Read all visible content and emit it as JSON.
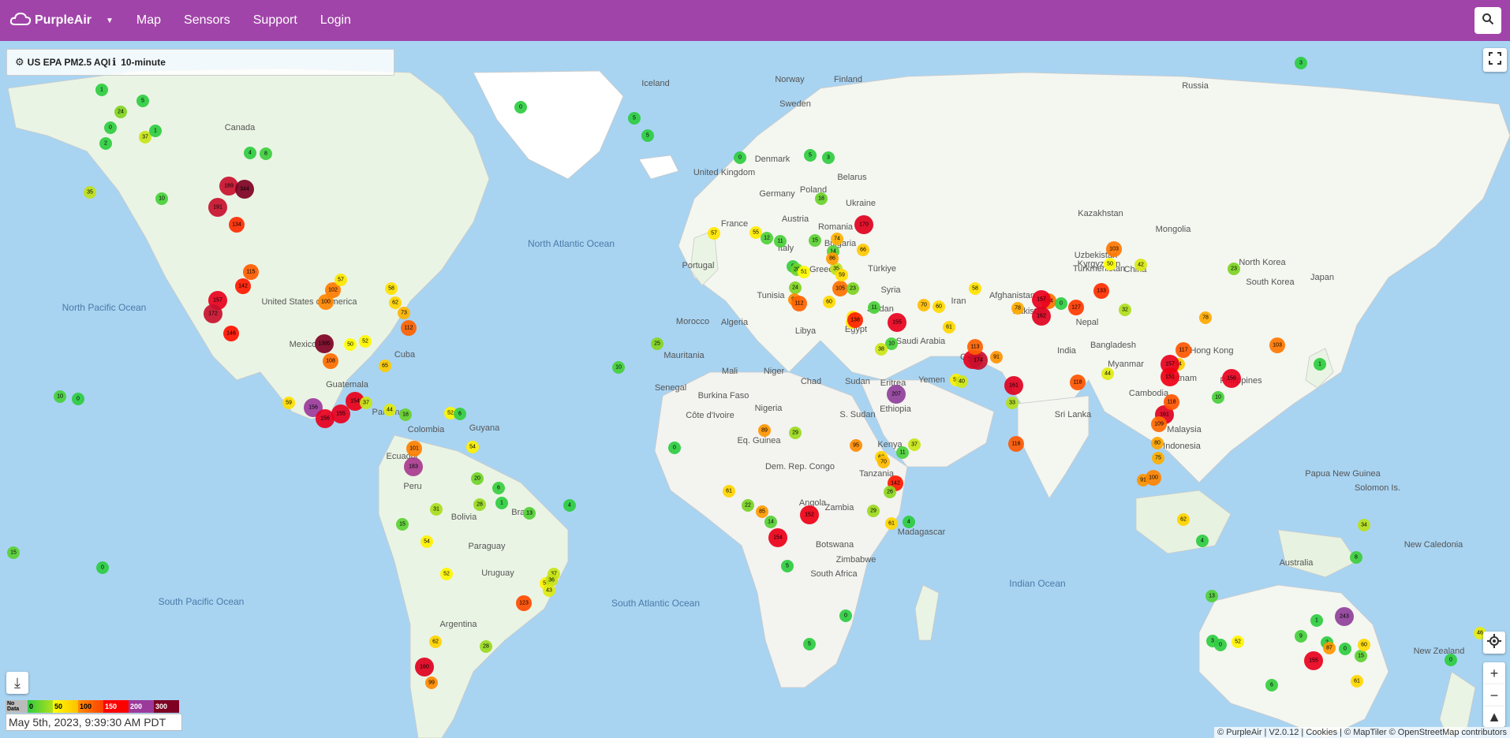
{
  "navbar": {
    "brand": "PurpleAir",
    "items": [
      {
        "label": "Map"
      },
      {
        "label": "Sensors"
      },
      {
        "label": "Support"
      },
      {
        "label": "Login"
      }
    ]
  },
  "panel": {
    "metric": "US EPA PM2.5 AQI",
    "interval": "10-minute"
  },
  "legend": {
    "no_data": "No Data",
    "ticks": [
      "0",
      "50",
      "100",
      "150",
      "200",
      "300"
    ],
    "colors": [
      "#2ecc40",
      "#ffff00",
      "#ff8c00",
      "#ff0000",
      "#9b3a9b",
      "#7e0023"
    ],
    "timestamp": "May 5th, 2023, 9:39:30 AM PDT"
  },
  "attribution": "© PurpleAir | V2.0.12 | Cookies | © MapTiler © OpenStreetMap contributors",
  "map_labels": {
    "countries": [
      "Canada",
      "United States of America",
      "Mexico",
      "Cuba",
      "Guatemala",
      "Panama",
      "Colombia",
      "Ecuador",
      "Peru",
      "Bolivia",
      "Brazil",
      "Paraguay",
      "Uruguay",
      "Argentina",
      "Guyana",
      "Iceland",
      "Norway",
      "Sweden",
      "Finland",
      "Denmark",
      "United Kingdom",
      "Germany",
      "France",
      "Portugal",
      "Italy",
      "Poland",
      "Austria",
      "Romania",
      "Bulgaria",
      "Greece",
      "Belarus",
      "Ukraine",
      "Türkiye",
      "Syria",
      "Jordan",
      "Tunisia",
      "Morocco",
      "Algeria",
      "Libya",
      "Egypt",
      "Mauritania",
      "Mali",
      "Niger",
      "Chad",
      "Sudan",
      "S. Sudan",
      "Eritrea",
      "Yemen",
      "Oman",
      "Saudi Arabia",
      "Iran",
      "Afghanistan",
      "Pakistan",
      "India",
      "Nepal",
      "Bangladesh",
      "Sri Lanka",
      "Myanmar",
      "Cambodia",
      "Vietnam",
      "Malaysia",
      "Indonesia",
      "Philippines",
      "Hong Kong",
      "China",
      "Mongolia",
      "Kazakhstan",
      "Uzbekistan",
      "Turkmenistan",
      "Kyrgyzstan",
      "North Korea",
      "South Korea",
      "Japan",
      "Russia",
      "Senegal",
      "Burkina Faso",
      "Côte d'Ivoire",
      "Nigeria",
      "Eq. Guinea",
      "Ethiopia",
      "Kenya",
      "Tanzania",
      "Dem. Rep. Congo",
      "Angola",
      "Zambia",
      "Zimbabwe",
      "Botswana",
      "South Africa",
      "Madagascar",
      "Papua New Guinea",
      "Solomon Is.",
      "New Caledonia",
      "Australia",
      "New Zealand"
    ],
    "oceans": [
      "North Pacific Ocean",
      "North Atlantic Ocean",
      "South Pacific Ocean",
      "South Atlantic Ocean",
      "Indian Ocean"
    ]
  },
  "sensors": [
    {
      "aqi": "1",
      "c": "#2ecc40"
    },
    {
      "aqi": "5",
      "c": "#2ecc40"
    },
    {
      "aqi": "24",
      "c": "#7fd321"
    },
    {
      "aqi": "37",
      "c": "#c8e417"
    },
    {
      "aqi": "0",
      "c": "#2ecc40"
    },
    {
      "aqi": "2",
      "c": "#2ecc40"
    },
    {
      "aqi": "35",
      "c": "#c0e11a"
    },
    {
      "aqi": "1",
      "c": "#2ecc40"
    },
    {
      "aqi": "10",
      "c": "#47cf3a"
    },
    {
      "aqi": "4",
      "c": "#2ecc40"
    },
    {
      "aqi": "8",
      "c": "#3ecd3d"
    },
    {
      "aqi": "189",
      "c": "#c8102e"
    },
    {
      "aqi": "344",
      "c": "#7e0023"
    },
    {
      "aqi": "191",
      "c": "#c8102e"
    },
    {
      "aqi": "134",
      "c": "#ff2a00"
    },
    {
      "aqi": "157",
      "c": "#e8001e"
    },
    {
      "aqi": "172",
      "c": "#c8102e"
    },
    {
      "aqi": "142",
      "c": "#ff1800"
    },
    {
      "aqi": "115",
      "c": "#ff5a00"
    },
    {
      "aqi": "146",
      "c": "#ff1000"
    },
    {
      "aqi": "102",
      "c": "#ff7a00"
    },
    {
      "aqi": "100",
      "c": "#ff8400"
    },
    {
      "aqi": "1395",
      "c": "#7e0023"
    },
    {
      "aqi": "108",
      "c": "#ff6c00"
    },
    {
      "aqi": "112",
      "c": "#ff6200"
    },
    {
      "aqi": "73",
      "c": "#ffb300"
    },
    {
      "aqi": "62",
      "c": "#ffd200"
    },
    {
      "aqi": "57",
      "c": "#ffe600"
    },
    {
      "aqi": "58",
      "c": "#ffe200"
    },
    {
      "aqi": "50",
      "c": "#ffff00"
    },
    {
      "aqi": "65",
      "c": "#ffca00"
    },
    {
      "aqi": "52",
      "c": "#fff500"
    },
    {
      "aqi": "59",
      "c": "#ffdd00"
    },
    {
      "aqi": "156",
      "c": "#9b3a9b"
    },
    {
      "aqi": "156",
      "c": "#e8001e"
    },
    {
      "aqi": "155",
      "c": "#e8001e"
    },
    {
      "aqi": "154",
      "c": "#ec0018"
    },
    {
      "aqi": "37",
      "c": "#c8e417"
    },
    {
      "aqi": "44",
      "c": "#e0ea10"
    },
    {
      "aqi": "18",
      "c": "#68d12b"
    },
    {
      "aqi": "52",
      "c": "#fff500"
    },
    {
      "aqi": "6",
      "c": "#36cd3f"
    },
    {
      "aqi": "25",
      "c": "#87d520"
    },
    {
      "aqi": "10",
      "c": "#47cf3a"
    },
    {
      "aqi": "0",
      "c": "#2ecc40"
    },
    {
      "aqi": "101",
      "c": "#ff7e00"
    },
    {
      "aqi": "183",
      "c": "#a83a8f"
    },
    {
      "aqi": "54",
      "c": "#fff000"
    },
    {
      "aqi": "20",
      "c": "#6fd229"
    },
    {
      "aqi": "31",
      "c": "#a8dc1c"
    },
    {
      "aqi": "28",
      "c": "#98d91e"
    },
    {
      "aqi": "1",
      "c": "#2ecc40"
    },
    {
      "aqi": "6",
      "c": "#36cd3f"
    },
    {
      "aqi": "13",
      "c": "#52cf36"
    },
    {
      "aqi": "4",
      "c": "#2ecc40"
    },
    {
      "aqi": "15",
      "c": "#5bd033"
    },
    {
      "aqi": "54",
      "c": "#fff000"
    },
    {
      "aqi": "52",
      "c": "#fff500"
    },
    {
      "aqi": "37",
      "c": "#c8e417"
    },
    {
      "aqi": "53",
      "c": "#fff200"
    },
    {
      "aqi": "36",
      "c": "#c4e218"
    },
    {
      "aqi": "43",
      "c": "#dce911"
    },
    {
      "aqi": "123",
      "c": "#ff4a00"
    },
    {
      "aqi": "62",
      "c": "#ffd200"
    },
    {
      "aqi": "160",
      "c": "#e00020"
    },
    {
      "aqi": "99",
      "c": "#ff8800"
    },
    {
      "aqi": "28",
      "c": "#98d91e"
    },
    {
      "aqi": "15",
      "c": "#5bd033"
    },
    {
      "aqi": "0",
      "c": "#2ecc40"
    },
    {
      "aqi": "0",
      "c": "#2ecc40"
    },
    {
      "aqi": "10",
      "c": "#47cf3a"
    },
    {
      "aqi": "0",
      "c": "#2ecc40"
    },
    {
      "aqi": "5",
      "c": "#2ecc40"
    },
    {
      "aqi": "5",
      "c": "#2ecc40"
    },
    {
      "aqi": "0",
      "c": "#2ecc40"
    },
    {
      "aqi": "3",
      "c": "#2ecc40"
    },
    {
      "aqi": "5",
      "c": "#2ecc40"
    },
    {
      "aqi": "18",
      "c": "#68d12b"
    },
    {
      "aqi": "57",
      "c": "#ffe600"
    },
    {
      "aqi": "55",
      "c": "#ffeb00"
    },
    {
      "aqi": "11",
      "c": "#4acf39"
    },
    {
      "aqi": "15",
      "c": "#5bd033"
    },
    {
      "aqi": "12",
      "c": "#4ecf37"
    },
    {
      "aqi": "6",
      "c": "#36cd3f"
    },
    {
      "aqi": "20",
      "c": "#6fd229"
    },
    {
      "aqi": "24",
      "c": "#7fd321"
    },
    {
      "aqi": "35",
      "c": "#c0e11a"
    },
    {
      "aqi": "14",
      "c": "#56cf35"
    },
    {
      "aqi": "74",
      "c": "#ffb000"
    },
    {
      "aqi": "51",
      "c": "#fffa00"
    },
    {
      "aqi": "86",
      "c": "#ff9a00"
    },
    {
      "aqi": "97",
      "c": "#ff8a00"
    },
    {
      "aqi": "112",
      "c": "#ff6200"
    },
    {
      "aqi": "60",
      "c": "#ffd900"
    },
    {
      "aqi": "55",
      "c": "#ffeb00"
    },
    {
      "aqi": "57",
      "c": "#ffe600"
    },
    {
      "aqi": "105",
      "c": "#ff7000"
    },
    {
      "aqi": "59",
      "c": "#ffdd00"
    },
    {
      "aqi": "66",
      "c": "#ffc800"
    },
    {
      "aqi": "23",
      "c": "#7cd322"
    },
    {
      "aqi": "138",
      "c": "#ff2200"
    },
    {
      "aqi": "170",
      "c": "#e0001c"
    },
    {
      "aqi": "11",
      "c": "#4acf39"
    },
    {
      "aqi": "10",
      "c": "#47cf3a"
    },
    {
      "aqi": "38",
      "c": "#cbe516"
    },
    {
      "aqi": "70",
      "c": "#ffbc00"
    },
    {
      "aqi": "155",
      "c": "#e8001e"
    },
    {
      "aqi": "60",
      "c": "#ffd900"
    },
    {
      "aqi": "61",
      "c": "#ffd600"
    },
    {
      "aqi": "58",
      "c": "#ffe200"
    },
    {
      "aqi": "78",
      "c": "#ffa800"
    },
    {
      "aqi": "104",
      "c": "#ff7200"
    },
    {
      "aqi": "0",
      "c": "#2ecc40"
    },
    {
      "aqi": "118",
      "c": "#ff5400"
    },
    {
      "aqi": "53",
      "c": "#fff200"
    },
    {
      "aqi": "40",
      "c": "#d2e714"
    },
    {
      "aqi": "91",
      "c": "#ff9200"
    },
    {
      "aqi": "157",
      "c": "#e8001e"
    },
    {
      "aqi": "207",
      "c": "#8f3f9a"
    },
    {
      "aqi": "161",
      "c": "#e00020"
    },
    {
      "aqi": "157",
      "c": "#e8001e"
    },
    {
      "aqi": "162",
      "c": "#e00020"
    },
    {
      "aqi": "127",
      "c": "#ff3800"
    },
    {
      "aqi": "44",
      "c": "#e0ea10"
    },
    {
      "aqi": "33",
      "c": "#b4de1b"
    },
    {
      "aqi": "116",
      "c": "#ff5800"
    },
    {
      "aqi": "174",
      "c": "#c8102e"
    },
    {
      "aqi": "113",
      "c": "#ff6000"
    },
    {
      "aqi": "103",
      "c": "#ff7600"
    },
    {
      "aqi": "42",
      "c": "#d8e813"
    },
    {
      "aqi": "50",
      "c": "#ffff00"
    },
    {
      "aqi": "32",
      "c": "#aedd1c"
    },
    {
      "aqi": "133",
      "c": "#ff2c00"
    },
    {
      "aqi": "78",
      "c": "#ffa800"
    },
    {
      "aqi": "23",
      "c": "#7cd322"
    },
    {
      "aqi": "117",
      "c": "#ff5600"
    },
    {
      "aqi": "64",
      "c": "#ffcc00"
    },
    {
      "aqi": "10",
      "c": "#47cf3a"
    },
    {
      "aqi": "157",
      "c": "#e8001e"
    },
    {
      "aqi": "161",
      "c": "#e00020"
    },
    {
      "aqi": "151",
      "c": "#ee0014"
    },
    {
      "aqi": "156",
      "c": "#e8001e"
    },
    {
      "aqi": "103",
      "c": "#ff7600"
    },
    {
      "aqi": "118",
      "c": "#ff5400"
    },
    {
      "aqi": "109",
      "c": "#ff6800"
    },
    {
      "aqi": "80",
      "c": "#ffa400"
    },
    {
      "aqi": "75",
      "c": "#ffae00"
    },
    {
      "aqi": "91",
      "c": "#ff9200"
    },
    {
      "aqi": "100",
      "c": "#ff8400"
    },
    {
      "aqi": "62",
      "c": "#ffd200"
    },
    {
      "aqi": "4",
      "c": "#2ecc40"
    },
    {
      "aqi": "34",
      "c": "#b8df1a"
    },
    {
      "aqi": "8",
      "c": "#3ecd3d"
    },
    {
      "aqi": "1",
      "c": "#2ecc40"
    },
    {
      "aqi": "3",
      "c": "#2ecc40"
    },
    {
      "aqi": "0",
      "c": "#2ecc40"
    },
    {
      "aqi": "52",
      "c": "#fff500"
    },
    {
      "aqi": "9",
      "c": "#43ce3b"
    },
    {
      "aqi": "2",
      "c": "#2ecc40"
    },
    {
      "aqi": "87",
      "c": "#ff9800"
    },
    {
      "aqi": "15",
      "c": "#5bd033"
    },
    {
      "aqi": "0",
      "c": "#2ecc40"
    },
    {
      "aqi": "60",
      "c": "#ffd900"
    },
    {
      "aqi": "61",
      "c": "#ffd600"
    },
    {
      "aqi": "155",
      "c": "#e8001e"
    },
    {
      "aqi": "243",
      "c": "#8f3f9a"
    },
    {
      "aqi": "1",
      "c": "#2ecc40"
    },
    {
      "aqi": "13",
      "c": "#52cf36"
    },
    {
      "aqi": "6",
      "c": "#36cd3f"
    },
    {
      "aqi": "0",
      "c": "#2ecc40"
    },
    {
      "aqi": "46",
      "c": "#e8ec0e"
    },
    {
      "aqi": "29",
      "c": "#9cda1d"
    },
    {
      "aqi": "89",
      "c": "#ff9500"
    },
    {
      "aqi": "61",
      "c": "#ffd600"
    },
    {
      "aqi": "22",
      "c": "#78d324"
    },
    {
      "aqi": "85",
      "c": "#ff9c00"
    },
    {
      "aqi": "14",
      "c": "#56cf35"
    },
    {
      "aqi": "154",
      "c": "#ec0018"
    },
    {
      "aqi": "152",
      "c": "#ee0014"
    },
    {
      "aqi": "95",
      "c": "#ff8c00"
    },
    {
      "aqi": "63",
      "c": "#ffd000"
    },
    {
      "aqi": "11",
      "c": "#4acf39"
    },
    {
      "aqi": "70",
      "c": "#ffbc00"
    },
    {
      "aqi": "142",
      "c": "#ff1800"
    },
    {
      "aqi": "26",
      "c": "#8cd71f"
    },
    {
      "aqi": "29",
      "c": "#9cda1d"
    },
    {
      "aqi": "61",
      "c": "#ffd600"
    },
    {
      "aqi": "37",
      "c": "#c8e417"
    },
    {
      "aqi": "4",
      "c": "#2ecc40"
    },
    {
      "aqi": "5",
      "c": "#2ecc40"
    },
    {
      "aqi": "0",
      "c": "#2ecc40"
    },
    {
      "aqi": "5",
      "c": "#2ecc40"
    },
    {
      "aqi": "3",
      "c": "#2ecc40"
    }
  ]
}
